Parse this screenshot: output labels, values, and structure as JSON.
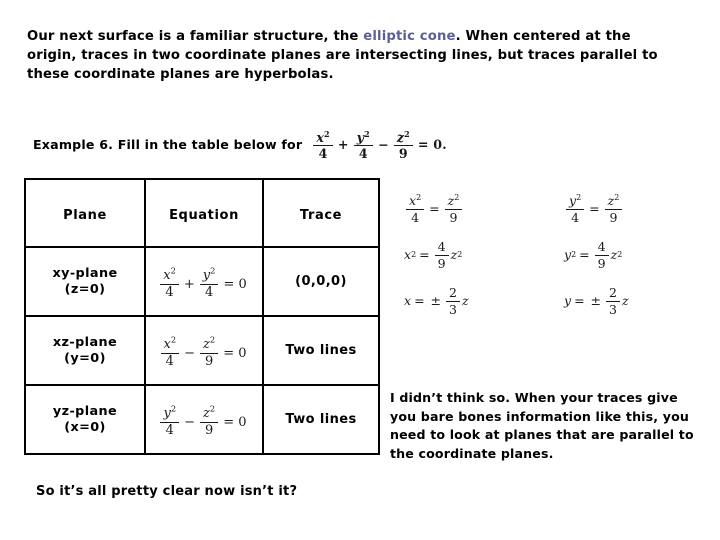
{
  "slide": {
    "background_color": "#ffffff",
    "text_color": "#000000",
    "accent_color": "#5b5f93"
  },
  "intro": {
    "part1": "Our next surface is a familiar structure, the ",
    "accent": "elliptic cone",
    "part2": ". When centered at the origin, traces in two coordinate planes are intersecting lines, but traces parallel to these coordinate planes are hyperbolas."
  },
  "example": {
    "label": "Example 6. Fill in the table below for",
    "equation": {
      "terms": [
        {
          "numerator": "x",
          "exponent": "2",
          "denominator": "4"
        },
        {
          "numerator": "y",
          "exponent": "2",
          "denominator": "4"
        },
        {
          "numerator": "z",
          "exponent": "2",
          "denominator": "9"
        }
      ],
      "op1": "+",
      "op2": "−",
      "equals": "= 0.",
      "plain": "x^2/4 + y^2/4 - z^2/9 = 0"
    }
  },
  "table": {
    "headers": [
      "Plane",
      "Equation",
      "Trace"
    ],
    "rows": [
      {
        "plane_name": "xy-plane",
        "plane_condition": "(z=0)",
        "equation_plain": "x^2/4 + y^2/4 = 0",
        "eq_var1": "x",
        "eq_den1": "4",
        "eq_op": "+",
        "eq_var2": "y",
        "eq_den2": "4",
        "eq_rhs": "= 0",
        "trace": "(0,0,0)"
      },
      {
        "plane_name": "xz-plane",
        "plane_condition": "(y=0)",
        "equation_plain": "x^2/4 - z^2/9 = 0",
        "eq_var1": "x",
        "eq_den1": "4",
        "eq_op": "−",
        "eq_var2": "z",
        "eq_den2": "9",
        "eq_rhs": "= 0",
        "trace": "Two lines"
      },
      {
        "plane_name": "yz-plane",
        "plane_condition": "(x=0)",
        "equation_plain": "y^2/4 - z^2/9 = 0",
        "eq_var1": "y",
        "eq_den1": "4",
        "eq_op": "−",
        "eq_var2": "z",
        "eq_den2": "9",
        "eq_rhs": "= 0",
        "trace": "Two lines"
      }
    ]
  },
  "derivations": {
    "left": {
      "step1_plain": "x^2/4 = z^2/9",
      "step2_plain": "x^2 = (4/9) z^2",
      "step3_plain": "x = +/- (2/3) z",
      "var": "x"
    },
    "right": {
      "step1_plain": "y^2/4 = z^2/9",
      "step2_plain": "y^2 = (4/9) z^2",
      "step3_plain": "y = +/- (2/3) z",
      "var": "y"
    },
    "common": {
      "den_left": "4",
      "den_right": "9",
      "z_var": "z",
      "exponent": "2",
      "frac_num": "4",
      "frac_den": "9",
      "root_num": "2",
      "root_den": "3",
      "equals": "=",
      "plusminus": "±"
    }
  },
  "notes": {
    "left": "So it’s all pretty clear now isn’t it?",
    "right": "I didn’t think so. When your traces give you bare bones information like this, you need to look at planes that are parallel to the coordinate planes."
  }
}
